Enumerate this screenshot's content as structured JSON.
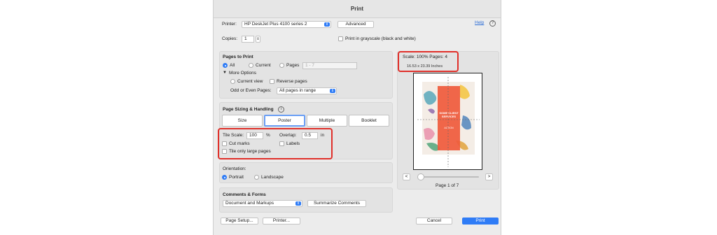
{
  "window": {
    "title": "Print"
  },
  "printer": {
    "label": "Printer:",
    "value": "HP DeskJet Plus 4100 series 2",
    "advanced_label": "Advanced",
    "help_label": "Help",
    "help_icon": "question-icon"
  },
  "copies": {
    "label": "Copies:",
    "value": "1",
    "grayscale_label": "Print in grayscale (black and white)"
  },
  "pages_to_print": {
    "heading": "Pages to Print",
    "all_label": "All",
    "current_label": "Current",
    "pages_label": "Pages",
    "pages_placeholder": "1 - 7",
    "more_options_label": "More Options",
    "current_view_label": "Current view",
    "reverse_pages_label": "Reverse pages",
    "odd_even_label": "Odd or Even Pages:",
    "odd_even_value": "All pages in range"
  },
  "sizing": {
    "heading": "Page Sizing & Handling",
    "info_icon": "info-icon",
    "tabs": [
      "Size",
      "Poster",
      "Multiple",
      "Booklet"
    ],
    "selected_tab": "Poster",
    "tile_scale_label": "Tile Scale:",
    "tile_scale_value": "100",
    "tile_scale_unit": "%",
    "overlap_label": "Overlap:",
    "overlap_value": "0.5",
    "overlap_unit": "in",
    "cut_marks_label": "Cut marks",
    "labels_label": "Labels",
    "tile_only_label": "Tile only large pages"
  },
  "orientation": {
    "heading": "Orientation:",
    "portrait_label": "Portrait",
    "landscape_label": "Landscape"
  },
  "comments": {
    "heading": "Comments & Forms",
    "value": "Document and Markups",
    "summarize_label": "Summarize Comments"
  },
  "preview": {
    "scale_text": "Scale: 100% Pages: 4",
    "size_text": "16.53 x 23.39 Inches",
    "poster_title": "SOME CLIENT SERVICES",
    "poster_sub": "ACTION",
    "prev_label": "<",
    "next_label": ">",
    "page_text": "Page 1 of 7"
  },
  "footer": {
    "page_setup_label": "Page Setup...",
    "printer_label": "Printer...",
    "cancel_label": "Cancel",
    "print_label": "Print"
  },
  "colors": {
    "accent": "#2f7cf6",
    "highlight": "#e0302a",
    "poster_orange": "#ef5a3c"
  }
}
